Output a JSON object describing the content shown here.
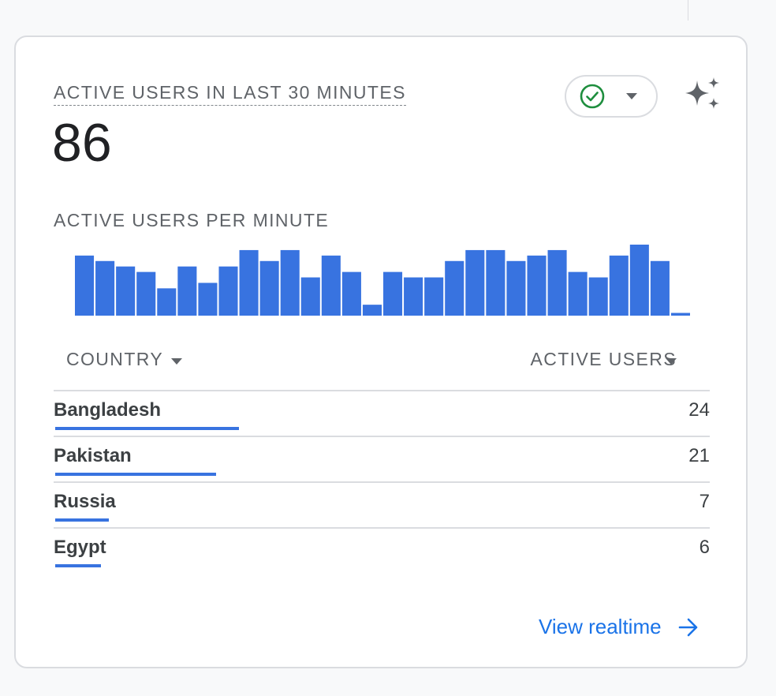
{
  "card": {
    "title": "ACTIVE USERS IN LAST 30 MINUTES",
    "value": "86",
    "chart_title": "ACTIVE USERS PER MINUTE"
  },
  "table": {
    "col_country": "COUNTRY",
    "col_users": "ACTIVE USERS",
    "rows": [
      {
        "country": "Bangladesh",
        "users": "24",
        "share": 0.28
      },
      {
        "country": "Pakistan",
        "users": "21",
        "share": 0.245
      },
      {
        "country": "Russia",
        "users": "7",
        "share": 0.082
      },
      {
        "country": "Egypt",
        "users": "6",
        "share": 0.07
      }
    ]
  },
  "footer": {
    "link": "View realtime"
  },
  "icons": {
    "check": "check-circle-icon",
    "dropdown": "caret-down-icon",
    "sparkle": "sparkle-icon",
    "arrow": "arrow-right-icon"
  },
  "colors": {
    "accent": "#1a73e8",
    "bar": "#3873e0",
    "check": "#1e8e3e",
    "muted": "#5f6368"
  },
  "chart_data": {
    "type": "bar",
    "title": "ACTIVE USERS PER MINUTE",
    "values": [
      11,
      10,
      9,
      8,
      5,
      9,
      6,
      9,
      12,
      10,
      12,
      7,
      11,
      8,
      2,
      8,
      7,
      7,
      10,
      12,
      12,
      10,
      11,
      12,
      8,
      7,
      11,
      13,
      10,
      0.5
    ],
    "ylim": [
      0,
      13
    ]
  }
}
